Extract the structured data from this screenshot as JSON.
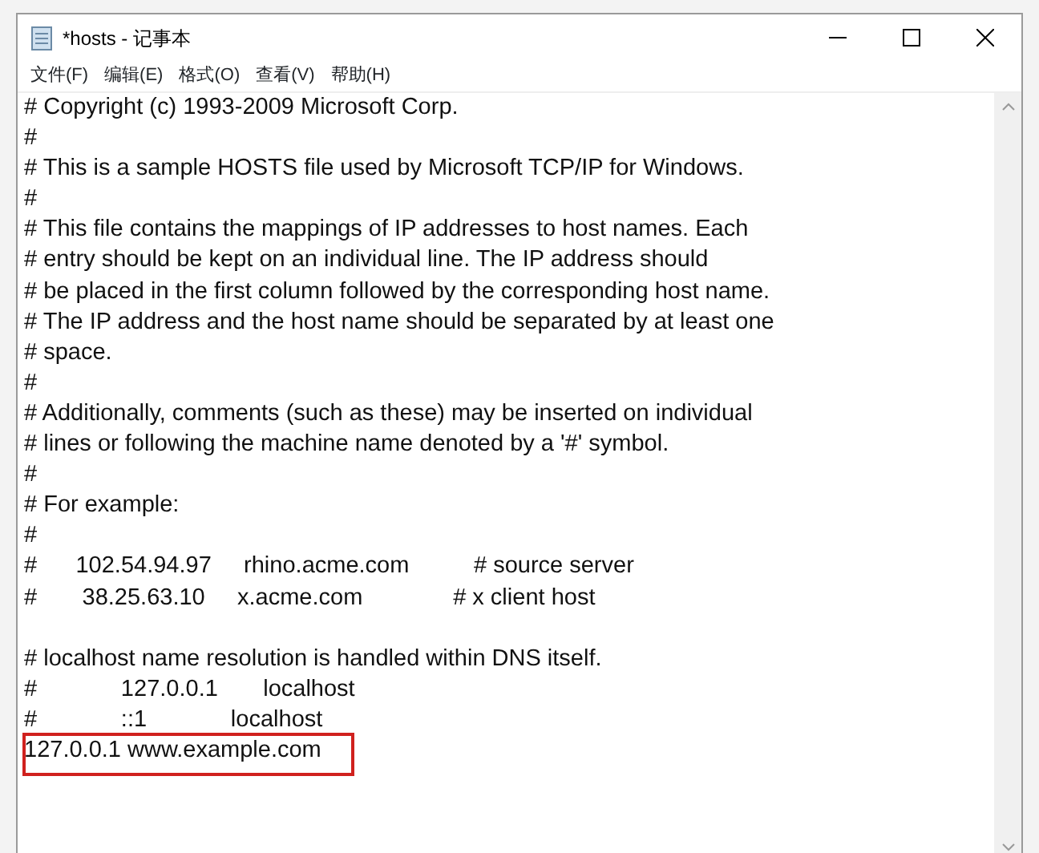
{
  "window": {
    "title": "*hosts - 记事本"
  },
  "menu": [
    "文件(F)",
    "编辑(E)",
    "格式(O)",
    "查看(V)",
    "帮助(H)"
  ],
  "editor": {
    "lines": [
      {
        "kind": "text",
        "text": "# Copyright (c) 1993-2009 Microsoft Corp.",
        "highlighted": false
      },
      {
        "kind": "text",
        "text": "#",
        "highlighted": false
      },
      {
        "kind": "text",
        "text": "# This is a sample HOSTS file used by Microsoft TCP/IP for Windows.",
        "highlighted": false
      },
      {
        "kind": "text",
        "text": "#",
        "highlighted": false
      },
      {
        "kind": "text",
        "text": "# This file contains the mappings of IP addresses to host names. Each",
        "highlighted": false
      },
      {
        "kind": "text",
        "text": "# entry should be kept on an individual line. The IP address should",
        "highlighted": false
      },
      {
        "kind": "text",
        "text": "# be placed in the first column followed by the corresponding host name.",
        "highlighted": false
      },
      {
        "kind": "text",
        "text": "# The IP address and the host name should be separated by at least one",
        "highlighted": false
      },
      {
        "kind": "text",
        "text": "# space.",
        "highlighted": false
      },
      {
        "kind": "text",
        "text": "#",
        "highlighted": false
      },
      {
        "kind": "text",
        "text": "# Additionally, comments (such as these) may be inserted on individual",
        "highlighted": false
      },
      {
        "kind": "text",
        "text": "# lines or following the machine name denoted by a '#' symbol.",
        "highlighted": false
      },
      {
        "kind": "text",
        "text": "#",
        "highlighted": false
      },
      {
        "kind": "text",
        "text": "# For example:",
        "highlighted": false
      },
      {
        "kind": "text",
        "text": "#",
        "highlighted": false
      },
      {
        "kind": "text",
        "text": "#      102.54.94.97     rhino.acme.com          # source server",
        "highlighted": false
      },
      {
        "kind": "text",
        "text": "#       38.25.63.10     x.acme.com              # x client host",
        "highlighted": false
      },
      {
        "kind": "blank"
      },
      {
        "kind": "text",
        "text": "# localhost name resolution is handled within DNS itself.",
        "highlighted": false
      },
      {
        "kind": "text",
        "text": "#             127.0.0.1       localhost",
        "highlighted": false
      },
      {
        "kind": "text",
        "text": "#             ::1             localhost",
        "highlighted": false
      },
      {
        "kind": "text",
        "text": "127.0.0.1 www.example.com",
        "highlighted": true
      }
    ]
  }
}
